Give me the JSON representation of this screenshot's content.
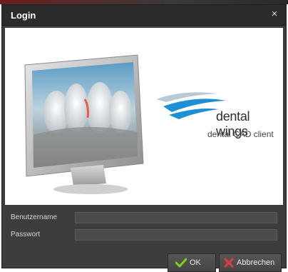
{
  "window": {
    "title": "Login",
    "close_glyph": "×"
  },
  "banner": {
    "brand_name": "dental wings",
    "product_name": "dental CAD client",
    "brand_color": "#1d8fd6"
  },
  "form": {
    "username_label": "Benutzername",
    "username_value": "",
    "password_label": "Passwort",
    "password_value": ""
  },
  "buttons": {
    "ok_label": "OK",
    "ok_icon": "checkmark-icon",
    "cancel_label": "Abbrechen",
    "cancel_icon": "red-x-icon"
  }
}
